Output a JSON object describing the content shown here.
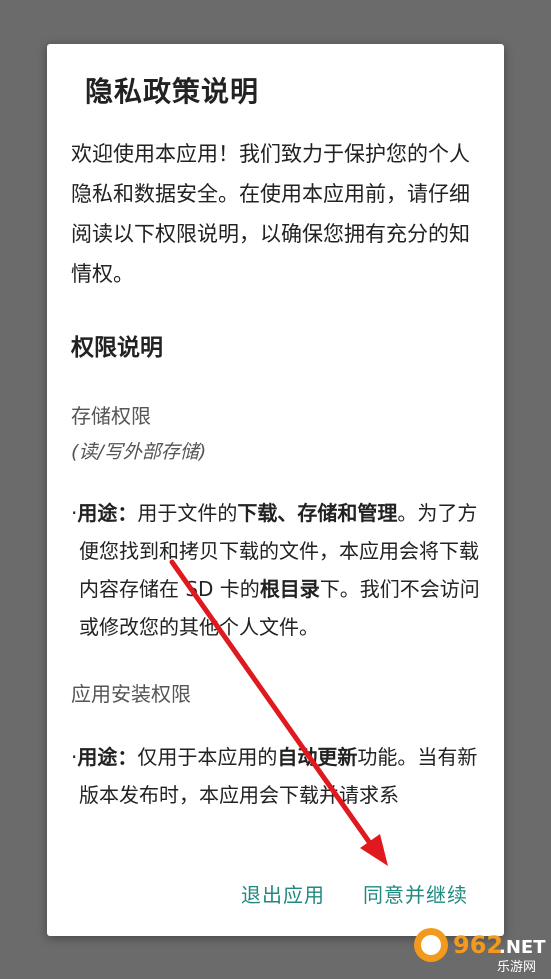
{
  "dialog": {
    "title": "隐私政策说明",
    "intro": "欢迎使用本应用！我们致力于保护您的个人隐私和数据安全。在使用本应用前，请仔细阅读以下权限说明，以确保您拥有充分的知情权。",
    "section_heading": "权限说明",
    "permissions": [
      {
        "title": "存储权限",
        "subtitle": "(读/写外部存储)",
        "bullet": "·",
        "usage_label": "用途：",
        "desc_1": "用于文件的",
        "desc_bold_1": "下载、存储和管理",
        "desc_2": "。为了方便您找到和拷贝下载的文件，本应用会将下载内容存储在 SD 卡的",
        "desc_bold_2": "根目录",
        "desc_3": "下。我们不会访问或修改您的其他个人文件。"
      },
      {
        "title": "应用安装权限",
        "bullet": "·",
        "usage_label": "用途：",
        "desc_1": "仅用于本应用的",
        "desc_bold_1": "自动更新",
        "desc_2": "功能。当有新版本发布时，本应用会下载并请求系"
      }
    ],
    "buttons": {
      "exit": "退出应用",
      "agree": "同意并继续"
    }
  },
  "watermark": {
    "number": "962",
    "suffix": ".NET",
    "sub": "乐游网"
  },
  "colors": {
    "overlay": "#6b6b6b",
    "accent": "#1f8a80",
    "arrow": "#e0191e"
  },
  "icons": [
    "annotation-arrow-icon",
    "watermark-logo-icon"
  ]
}
